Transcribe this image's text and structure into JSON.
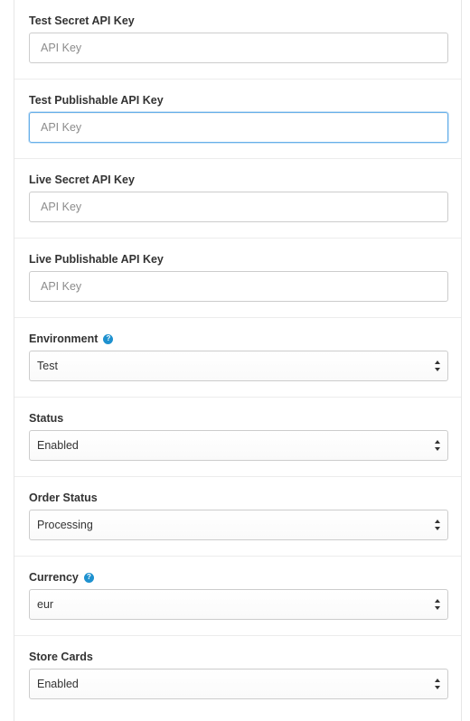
{
  "fields": [
    {
      "label": "Test Secret API Key",
      "placeholder": "API Key",
      "value": ""
    },
    {
      "label": "Test Publishable API Key",
      "placeholder": "API Key",
      "value": ""
    },
    {
      "label": "Live Secret API Key",
      "placeholder": "API Key",
      "value": ""
    },
    {
      "label": "Live Publishable API Key",
      "placeholder": "API Key",
      "value": ""
    }
  ],
  "selects": [
    {
      "label": "Environment",
      "value": "Test",
      "help_icon": "question-circle-icon"
    },
    {
      "label": "Status",
      "value": "Enabled"
    },
    {
      "label": "Order Status",
      "value": "Processing"
    },
    {
      "label": "Currency",
      "value": "eur",
      "help_icon": "question-circle-icon"
    },
    {
      "label": "Store Cards",
      "value": "Enabled"
    }
  ],
  "help_icon_glyph": "?",
  "colors": {
    "accent": "#1e91cf",
    "focus_border": "#66afe9",
    "input_border": "#cccccc"
  }
}
